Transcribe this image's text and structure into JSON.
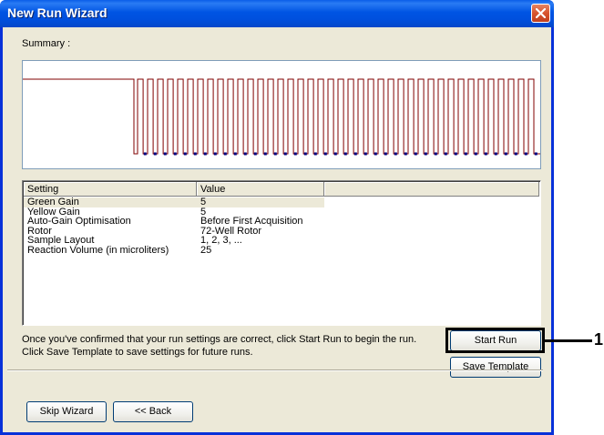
{
  "window": {
    "title": "New Run Wizard",
    "close_icon": "close-icon"
  },
  "summary": {
    "label": "Summary :"
  },
  "chart_data": {
    "type": "line",
    "description_series": "temperature profile",
    "hold_level": 1.0,
    "hold_end": 0.2,
    "cycles": 40,
    "high": 1.0,
    "low": 0.0,
    "line_color": "#800000",
    "acquisition_marker_color": "#000080"
  },
  "grid": {
    "headers": [
      "Setting",
      "Value",
      ""
    ],
    "rows": [
      {
        "setting": "Green Gain",
        "value": "5"
      },
      {
        "setting": "Yellow Gain",
        "value": "5"
      },
      {
        "setting": "Auto-Gain Optimisation",
        "value": "Before First Acquisition"
      },
      {
        "setting": "Rotor",
        "value": "72-Well Rotor"
      },
      {
        "setting": "Sample Layout",
        "value": "1, 2, 3, ..."
      },
      {
        "setting": "Reaction Volume (in microliters)",
        "value": "25"
      }
    ],
    "selected_row": 0
  },
  "info_text": "Once you've confirmed that your run settings are correct, click Start Run to begin the run. Click Save Template to save settings for future runs.",
  "buttons": {
    "start_run": "Start Run",
    "save_template": "Save Template",
    "skip_wizard": "Skip Wizard",
    "back": "<< Back"
  },
  "callout": {
    "number": "1"
  }
}
